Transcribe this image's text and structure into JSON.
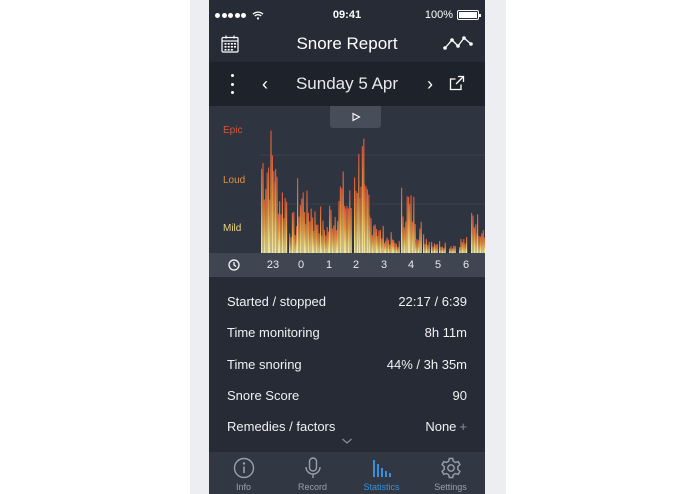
{
  "status_bar": {
    "time": "09:41",
    "battery": "100%",
    "battery_level": 1.0
  },
  "header": {
    "title": "Snore Report",
    "left_icon": "calendar-icon",
    "right_icon": "trend-chart-icon"
  },
  "date_bar": {
    "date": "Sunday 5 Apr",
    "prev": "‹",
    "next": "›"
  },
  "chart": {
    "play_icon": "play-icon",
    "levels": [
      "Epic",
      "Loud",
      "Mild"
    ],
    "time_ticks": [
      "23",
      "0",
      "1",
      "2",
      "3",
      "4",
      "5",
      "6"
    ]
  },
  "stats": [
    {
      "label": "Started / stopped",
      "value": "22:17 / 6:39"
    },
    {
      "label": "Time monitoring",
      "value": "8h 11m"
    },
    {
      "label": "Time snoring",
      "value": "44% / 3h 35m"
    },
    {
      "label": "Snore Score",
      "value": "90"
    },
    {
      "label": "Remedies / factors",
      "value": "None",
      "extra": "+"
    }
  ],
  "tabs": [
    {
      "label": "Info",
      "icon": "info-icon",
      "active": false
    },
    {
      "label": "Record",
      "icon": "microphone-icon",
      "active": false
    },
    {
      "label": "Statistics",
      "icon": "bar-chart-icon",
      "active": true
    },
    {
      "label": "Settings",
      "icon": "gear-icon",
      "active": false
    }
  ],
  "colors": {
    "background": "#262b36",
    "chart_bg": "#2e3440",
    "epic": "#d9543a",
    "loud": "#e2913c",
    "mild": "#e9d57c",
    "active_tab": "#3a8fd8"
  }
}
